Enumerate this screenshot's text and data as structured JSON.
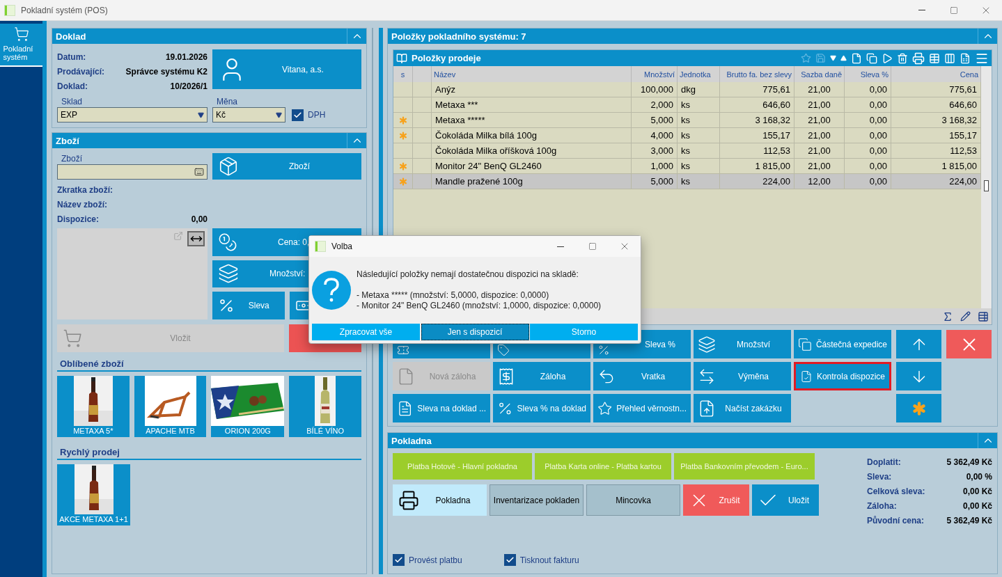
{
  "window": {
    "title": "Pokladní systém (POS)"
  },
  "sidebar": {
    "items": [
      {
        "label": "Pokladní systém",
        "selected": true
      }
    ]
  },
  "doklad": {
    "title": "Doklad",
    "fields": [
      {
        "label": "Datum:",
        "value": "19.01.2026"
      },
      {
        "label": "Prodávající:",
        "value": "Správce systému K2"
      },
      {
        "label": "Doklad:",
        "value": "10/2026/1"
      }
    ],
    "customer": "Vitana, a.s.",
    "warehouse": {
      "label": "Sklad",
      "value": "EXP"
    },
    "currency": {
      "label": "Měna",
      "value": "Kč"
    },
    "vat": {
      "label": "DPH",
      "checked": true
    }
  },
  "goods": {
    "title": "Zboží",
    "field_label": "Zboží",
    "button": "Zboží",
    "fields": [
      {
        "label": "Zkratka zboží:"
      },
      {
        "label": "Název zboží:"
      },
      {
        "label": "Dispozice:",
        "value": "0,00"
      }
    ],
    "price_button": "Cena: 0,",
    "quantity_button": "Množství:",
    "discount_button": "Sleva",
    "insert": {
      "label": "Vložit",
      "disabled": true
    }
  },
  "favorites": {
    "title": "Oblíbené zboží",
    "items": [
      {
        "label": "METAXA 5*",
        "kind": "picture"
      },
      {
        "label": "APACHE MTB",
        "kind": "picture"
      },
      {
        "label": "ORION 200G",
        "kind": "picture"
      },
      {
        "label": "BÍLÉ VÍNO",
        "kind": "picture"
      }
    ]
  },
  "quick_sale": {
    "title": "Rychlý prodej",
    "items": [
      {
        "label": "AKCE METAXA 1+1",
        "kind": "picture"
      }
    ]
  },
  "items": {
    "title": "Položky pokladního systému: 7",
    "grid_title": "Položky prodeje",
    "columns": [
      "s",
      "",
      "Název",
      "Množství",
      "Jednotka",
      "Brutto fa. bez slevy",
      "Sazba daně",
      "Sleva %",
      "Cena"
    ],
    "rows": [
      {
        "starred": false,
        "selected": false,
        "cells": [
          "",
          "",
          "Anýz",
          "100,000",
          "dkg",
          "775,61",
          "21,00",
          "0,00",
          "775,61"
        ]
      },
      {
        "starred": false,
        "selected": false,
        "cells": [
          "",
          "",
          "Metaxa ***",
          "2,000",
          "ks",
          "646,60",
          "21,00",
          "0,00",
          "646,60"
        ]
      },
      {
        "starred": true,
        "selected": false,
        "cells": [
          "",
          "",
          "Metaxa *****",
          "5,000",
          "ks",
          "3 168,32",
          "21,00",
          "0,00",
          "3 168,32"
        ]
      },
      {
        "starred": true,
        "selected": false,
        "cells": [
          "",
          "",
          "Čokoláda Milka bílá 100g",
          "4,000",
          "ks",
          "155,17",
          "21,00",
          "0,00",
          "155,17"
        ]
      },
      {
        "starred": false,
        "selected": false,
        "cells": [
          "",
          "",
          "Čokoláda Milka oříšková 100g",
          "3,000",
          "ks",
          "112,53",
          "21,00",
          "0,00",
          "112,53"
        ]
      },
      {
        "starred": true,
        "selected": false,
        "cells": [
          "",
          "",
          "Monitor 24\" BenQ GL2460",
          "1,000",
          "ks",
          "1 815,00",
          "21,00",
          "0,00",
          "1 815,00"
        ]
      },
      {
        "starred": true,
        "selected": true,
        "cells": [
          "",
          "",
          "Mandle pražené 100g",
          "5,000",
          "ks",
          "224,00",
          "12,00",
          "0,00",
          "224,00"
        ]
      }
    ]
  },
  "actions": [
    {
      "disabled": false,
      "highlighted": false
    },
    {
      "disabled": false,
      "highlighted": false
    },
    {
      "label": "Sleva %",
      "disabled": false,
      "highlighted": false
    },
    {
      "label": "Množství",
      "disabled": false,
      "highlighted": false
    },
    {
      "label": "Částečná expedice",
      "disabled": false,
      "highlighted": false
    },
    {
      "label": "Nová záloha",
      "disabled": true,
      "highlighted": false
    },
    {
      "label": "Záloha",
      "disabled": false,
      "highlighted": false
    },
    {
      "label": "Vratka",
      "disabled": false,
      "highlighted": false
    },
    {
      "label": "Výměna",
      "disabled": false,
      "highlighted": false
    },
    {
      "label": "Kontrola dispozice",
      "disabled": false,
      "highlighted": true
    },
    {
      "label": "Sleva na doklad ...",
      "disabled": false,
      "highlighted": false
    },
    {
      "label": "Sleva % na doklad",
      "disabled": false,
      "highlighted": false
    },
    {
      "label": "Přehled věrnostn...",
      "disabled": false,
      "highlighted": false
    },
    {
      "label": "Načíst zakázku",
      "disabled": false,
      "highlighted": false
    }
  ],
  "pokladna": {
    "title": "Pokladna",
    "payments": [
      "Platba Hotově - Hlavní pokladna",
      "Platba Karta online - Platba kartou",
      "Platba Bankovním převodem - Euro..."
    ],
    "buttons": [
      {
        "label": "Pokladna",
        "kind": "light"
      },
      {
        "label": "Inventarizace pokladen",
        "kind": "grey"
      },
      {
        "label": "Mincovka",
        "kind": "grey"
      },
      {
        "label": "Zrušit",
        "kind": "red"
      },
      {
        "label": "Uložit",
        "kind": "blue"
      }
    ],
    "summary": [
      {
        "label": "Doplatit:",
        "value": "5 362,49 Kč"
      },
      {
        "label": "Sleva:",
        "value": "0,00 %"
      },
      {
        "label": "Celková sleva:",
        "value": "0,00 Kč"
      },
      {
        "label": "Záloha:",
        "value": "0,00 Kč"
      },
      {
        "label": "Původní cena:",
        "value": "5 362,49 Kč"
      }
    ],
    "checkboxes": [
      {
        "label": "Provést platbu",
        "checked": true
      },
      {
        "label": "Tisknout fakturu",
        "checked": true
      }
    ]
  },
  "dialog": {
    "title": "Volba",
    "message": "Následující položky nemají dostatečnou dispozici na skladě:",
    "lines": [
      "- Metaxa ***** (množství: 5,0000, dispozice: 0,0000)",
      "- Monitor 24\" BenQ GL2460 (množství: 1,0000, dispozice: 0,0000)"
    ],
    "buttons": [
      {
        "label": "Zpracovat vše",
        "selected": false
      },
      {
        "label": "Jen s dispozicí",
        "selected": true
      },
      {
        "label": "Storno",
        "selected": false
      }
    ]
  }
}
